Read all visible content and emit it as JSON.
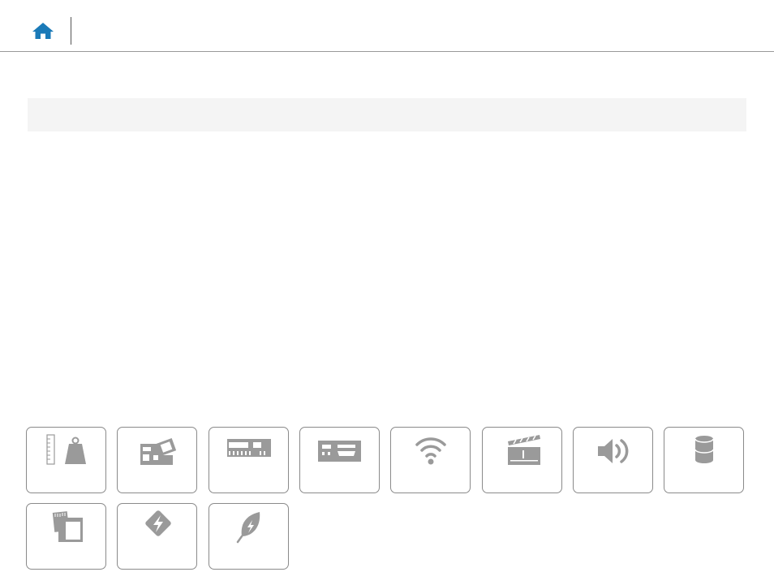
{
  "header": {
    "home_icon": "home-icon",
    "accent": "#1a7ab8"
  },
  "title_bar": {
    "title": ""
  },
  "tiles": [
    {
      "icon": "dimensions-weight-icon",
      "label": ""
    },
    {
      "icon": "system-board-icon",
      "label": ""
    },
    {
      "icon": "memory-icon",
      "label": ""
    },
    {
      "icon": "ports-connectors-icon",
      "label": ""
    },
    {
      "icon": "wireless-icon",
      "label": ""
    },
    {
      "icon": "video-icon",
      "label": ""
    },
    {
      "icon": "audio-icon",
      "label": ""
    },
    {
      "icon": "storage-icon",
      "label": ""
    },
    {
      "icon": "media-card-icon",
      "label": ""
    },
    {
      "icon": "power-icon",
      "label": ""
    },
    {
      "icon": "environmental-icon",
      "label": ""
    }
  ]
}
